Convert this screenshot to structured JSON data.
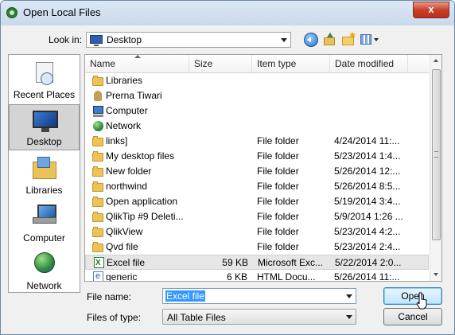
{
  "window": {
    "title": "Open Local Files",
    "close_glyph": "x"
  },
  "toolbar": {
    "lookin_label": "Look in:",
    "lookin_value": "Desktop",
    "icons": [
      "back-icon",
      "up-folder-icon",
      "new-folder-icon",
      "views-menu-icon"
    ]
  },
  "places": [
    {
      "label": "Recent Places",
      "icon": "recent-places-icon"
    },
    {
      "label": "Desktop",
      "icon": "desktop-icon",
      "selected": true
    },
    {
      "label": "Libraries",
      "icon": "libraries-icon"
    },
    {
      "label": "Computer",
      "icon": "computer-icon"
    },
    {
      "label": "Network",
      "icon": "network-icon"
    }
  ],
  "columns": {
    "name": "Name",
    "size": "Size",
    "type": "Item type",
    "date": "Date modified"
  },
  "files": [
    {
      "name": "Libraries",
      "size": "",
      "type": "",
      "date": "",
      "icon": "library-folder-icon"
    },
    {
      "name": "Prerna Tiwari",
      "size": "",
      "type": "",
      "date": "",
      "icon": "user-folder-icon"
    },
    {
      "name": "Computer",
      "size": "",
      "type": "",
      "date": "",
      "icon": "computer-icon"
    },
    {
      "name": "Network",
      "size": "",
      "type": "",
      "date": "",
      "icon": "network-icon"
    },
    {
      "name": "links]",
      "size": "",
      "type": "File folder",
      "date": "4/24/2014 11:...",
      "icon": "folder-icon"
    },
    {
      "name": "My desktop files",
      "size": "",
      "type": "File folder",
      "date": "5/23/2014 1:4...",
      "icon": "folder-icon"
    },
    {
      "name": "New folder",
      "size": "",
      "type": "File folder",
      "date": "5/26/2014 12:...",
      "icon": "folder-icon"
    },
    {
      "name": "northwind",
      "size": "",
      "type": "File folder",
      "date": "5/26/2014 8:5...",
      "icon": "folder-icon"
    },
    {
      "name": "Open application",
      "size": "",
      "type": "File folder",
      "date": "5/19/2014 3:4...",
      "icon": "folder-icon"
    },
    {
      "name": "QlikTip #9  Deleti...",
      "size": "",
      "type": "File folder",
      "date": "5/9/2014 1:26 ...",
      "icon": "folder-icon"
    },
    {
      "name": "QlikView",
      "size": "",
      "type": "File folder",
      "date": "5/23/2014 4:2...",
      "icon": "folder-icon"
    },
    {
      "name": "Qvd file",
      "size": "",
      "type": "File folder",
      "date": "5/23/2014 2:4...",
      "icon": "folder-icon"
    },
    {
      "name": "Excel file",
      "size": "59 KB",
      "type": "Microsoft Exc...",
      "date": "5/22/2014 2:0...",
      "icon": "excel-file-icon",
      "selected": true
    },
    {
      "name": "generic",
      "size": "6 KB",
      "type": "HTML Docu...",
      "date": "5/26/2014 11:...",
      "icon": "html-file-icon"
    }
  ],
  "bottom": {
    "filename_label": "File name:",
    "filename_value": "Excel file",
    "filetype_label": "Files of type:",
    "filetype_value": "All Table Files",
    "open_label": "Open",
    "cancel_label": "Cancel"
  }
}
